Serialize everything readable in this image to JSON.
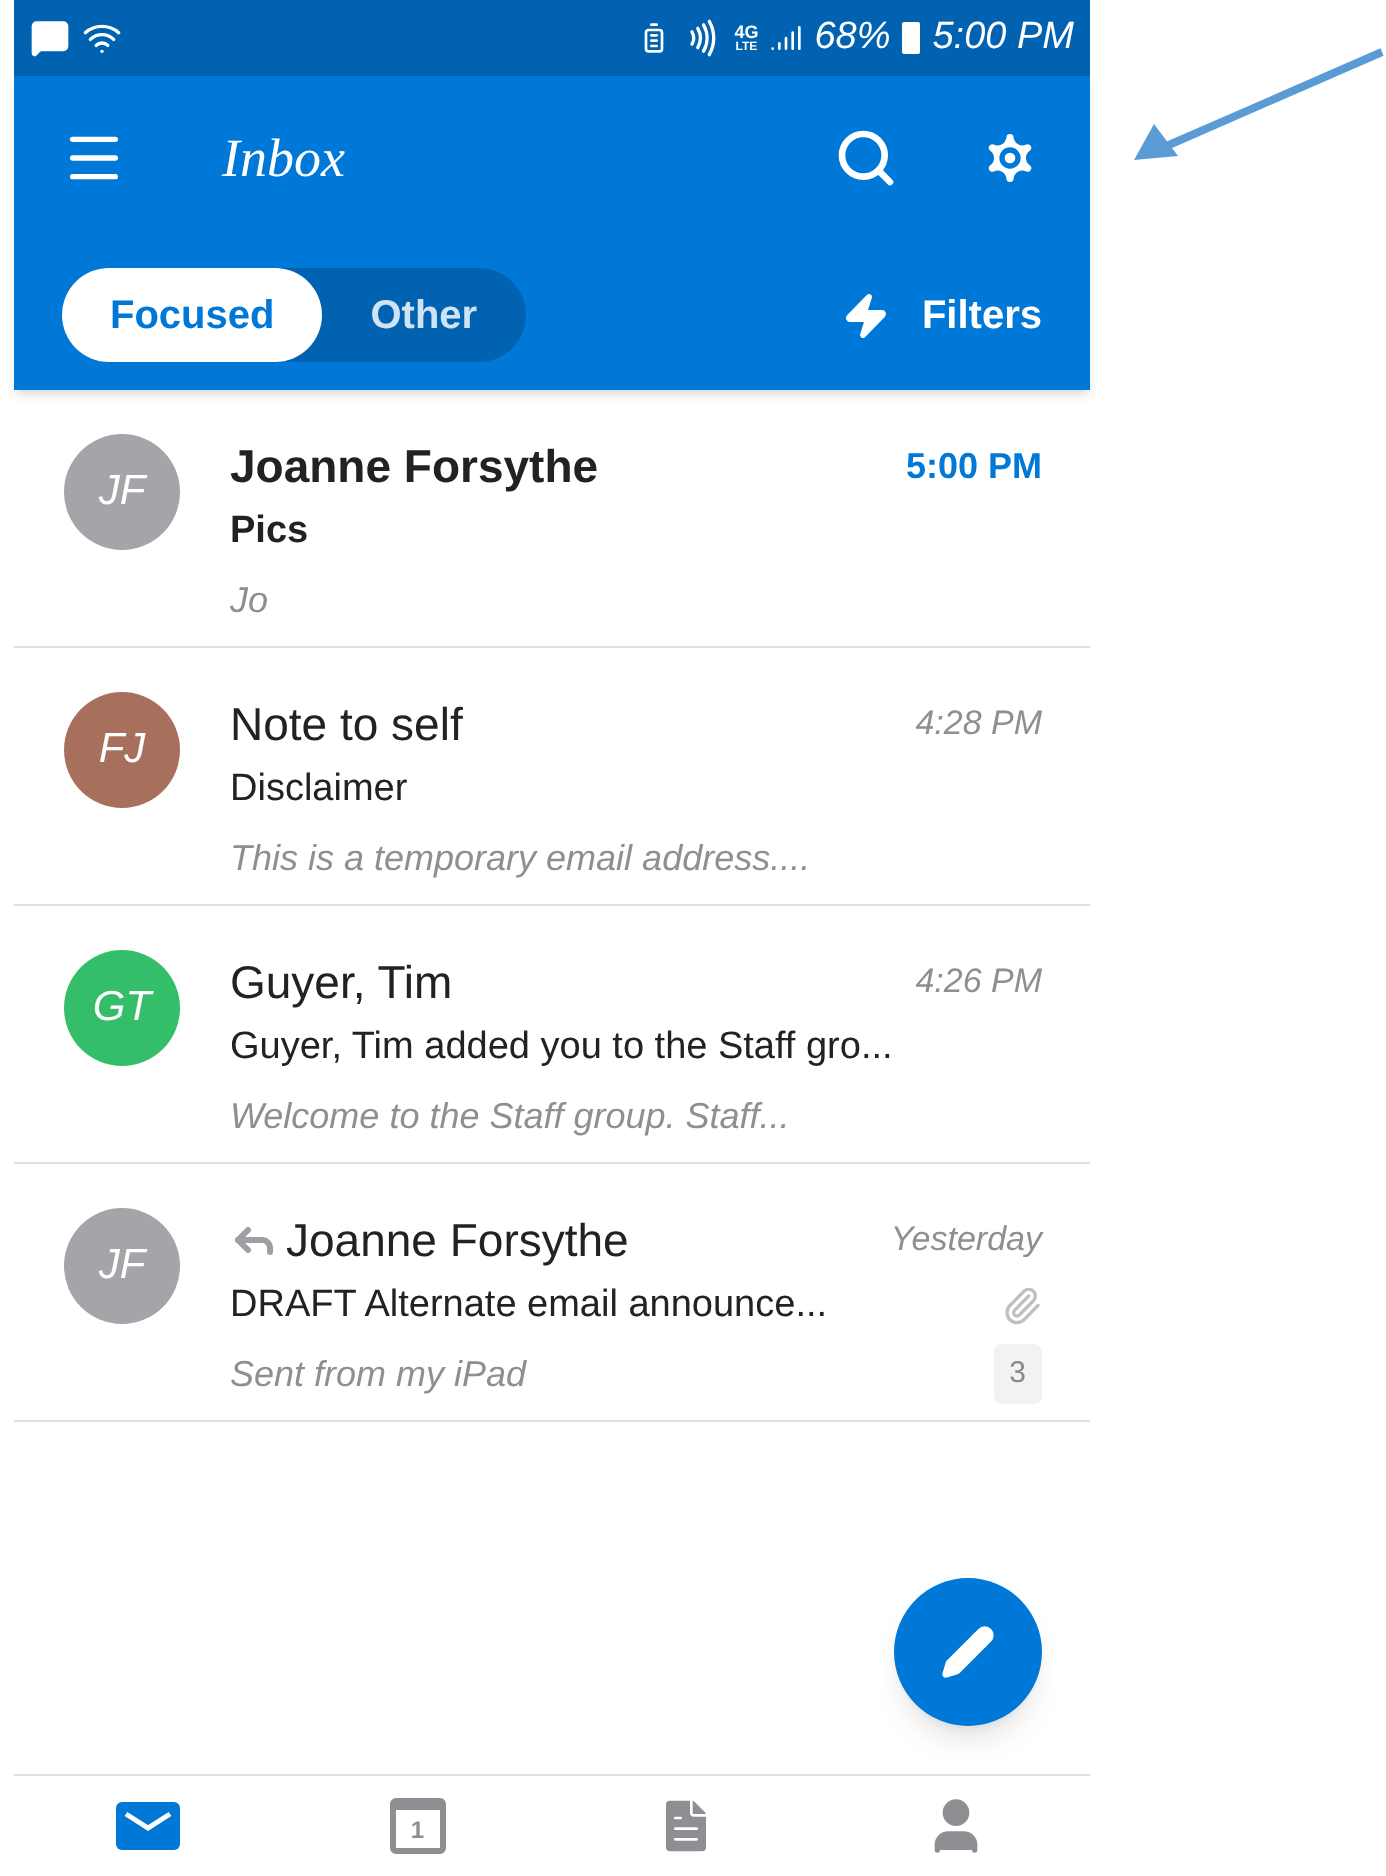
{
  "status_bar": {
    "network": "4G",
    "network_sub": "LTE",
    "battery": "68%",
    "time": "5:00 PM"
  },
  "toolbar": {
    "title": "Inbox"
  },
  "tabs": [
    {
      "label": "Focused",
      "selected": true
    },
    {
      "label": "Other",
      "selected": false
    }
  ],
  "filters": {
    "label": "Filters"
  },
  "messages": [
    {
      "initials": "JF",
      "color": "#a5a4a9",
      "sender": "Joanne Forsythe",
      "time": "5:00 PM",
      "subject": "Pics",
      "preview": "Jo",
      "unread": true,
      "replied": false,
      "attachment": false
    },
    {
      "initials": "FJ",
      "color": "#a86f5c",
      "sender": "Note to self",
      "time": "4:28 PM",
      "subject": "Disclaimer",
      "preview": "This is a temporary email address....",
      "unread": false,
      "replied": false,
      "attachment": false
    },
    {
      "initials": "GT",
      "color": "#34be6a",
      "sender": "Guyer, Tim",
      "time": "4:26 PM",
      "subject": "Guyer, Tim added you to the Staff gro...",
      "preview": "Welcome to the Staff group. Staff...",
      "unread": false,
      "replied": false,
      "attachment": false
    },
    {
      "initials": "JF",
      "color": "#a5a4a9",
      "sender": "Joanne Forsythe",
      "time": "Yesterday",
      "subject": "DRAFT Alternate email announce...",
      "preview": "Sent from my iPad",
      "unread": false,
      "replied": true,
      "attachment": true,
      "thread_count": "3"
    }
  ],
  "bottom_nav": [
    {
      "kind": "mail",
      "selected": true
    },
    {
      "kind": "calendar",
      "selected": false,
      "day": "1"
    },
    {
      "kind": "files",
      "selected": false
    },
    {
      "kind": "people",
      "selected": false
    }
  ]
}
